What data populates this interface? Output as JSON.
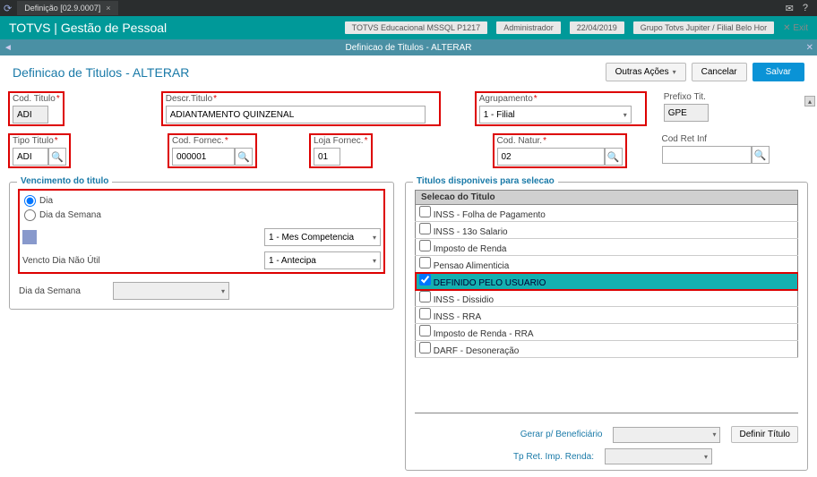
{
  "tab": {
    "label": "Definição [02.9.0007]"
  },
  "app_title": "TOTVS | Gestão de Pessoal",
  "header_right": {
    "env": "TOTVS Educacional MSSQL P1217",
    "user": "Administrador",
    "date": "22/04/2019",
    "company": "Grupo Totvs Jupiter / Filial Belo Hor",
    "exit": "Exit"
  },
  "subheader": "Definicao de Titulos - ALTERAR",
  "page_title": "Definicao de Titulos - ALTERAR",
  "buttons": {
    "outras": "Outras Ações",
    "cancelar": "Cancelar",
    "salvar": "Salvar",
    "definir": "Definir Título"
  },
  "fields": {
    "cod_titulo_label": "Cod. Titulo",
    "cod_titulo_value": "ADI",
    "descr_titulo_label": "Descr.Titulo",
    "descr_titulo_value": "ADIANTAMENTO QUINZENAL",
    "agrupamento_label": "Agrupamento",
    "agrupamento_value": "1 - Filial",
    "prefixo_label": "Prefixo Tit.",
    "prefixo_value": "GPE",
    "tipo_titulo_label": "Tipo Titulo",
    "tipo_titulo_value": "ADI",
    "cod_fornec_label": "Cod. Fornec.",
    "cod_fornec_value": "000001",
    "loja_fornec_label": "Loja Fornec.",
    "loja_fornec_value": "01",
    "cod_natur_label": "Cod. Natur.",
    "cod_natur_value": "02",
    "cod_ret_label": "Cod Ret Inf",
    "cod_ret_value": ""
  },
  "vencimento": {
    "legend": "Vencimento do titulo",
    "radio_dia": "Dia",
    "radio_dia_semana": "Dia da Semana",
    "mes_ref": "1 - Mes Competencia",
    "vencto_label": "Vencto Dia Não Útil",
    "vencto_value": "1 - Antecipa",
    "dia_semana_label": "Dia da Semana"
  },
  "titulos": {
    "legend": "Titulos disponiveis para selecao",
    "header": "Selecao do Titulo",
    "items": [
      "INSS - Folha de Pagamento",
      "INSS - 13o Salario",
      "Imposto de Renda",
      "Pensao Alimenticia",
      "DEFINIDO PELO USUARIO",
      "INSS - Dissidio",
      "INSS - RRA",
      "Imposto de Renda - RRA",
      "DARF - Desoneração"
    ],
    "selected_index": 4
  },
  "bottom": {
    "gerar_label": "Gerar p/ Beneficiário",
    "tp_ret_label": "Tp Ret. Imp. Renda:"
  }
}
